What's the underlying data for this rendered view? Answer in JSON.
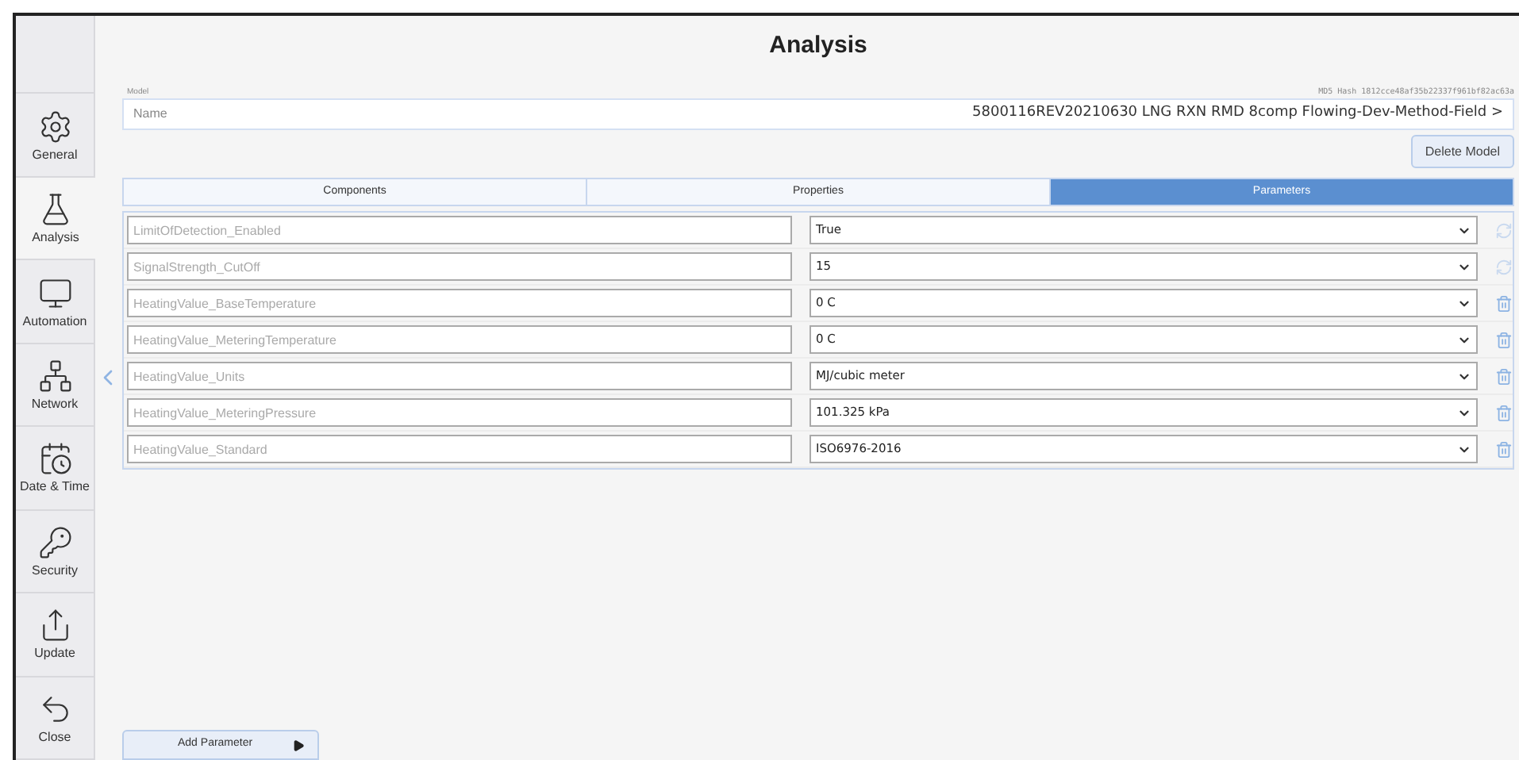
{
  "title": "Analysis",
  "sidebar": {
    "items": [
      {
        "kind": "gear",
        "label": "General",
        "selected": false
      },
      {
        "kind": "flask",
        "label": "Analysis",
        "selected": true
      },
      {
        "kind": "monitor",
        "label": "Automation",
        "selected": false
      },
      {
        "kind": "network",
        "label": "Network",
        "selected": false
      },
      {
        "kind": "calendar",
        "label": "Date & Time",
        "selected": false
      },
      {
        "kind": "key",
        "label": "Security",
        "selected": false
      },
      {
        "kind": "upload",
        "label": "Update",
        "selected": false
      },
      {
        "kind": "back",
        "label": "Close",
        "selected": false
      }
    ]
  },
  "model": {
    "label": "Model",
    "hash": "MD5 Hash 1812cce48af35b22337f961bf82ac63a",
    "name_label": "Name",
    "name_value": "5800116REV20210630 LNG RXN RMD 8comp Flowing-Dev-Method-Field >",
    "delete_button": "Delete Model"
  },
  "tabs": [
    {
      "label": "Components",
      "selected": false
    },
    {
      "label": "Properties",
      "selected": false
    },
    {
      "label": "Parameters",
      "selected": true
    }
  ],
  "parameters": [
    {
      "placeholder": "LimitOfDetection_Enabled",
      "value": "True",
      "kind": "reset"
    },
    {
      "placeholder": "SignalStrength_CutOff",
      "value": "15",
      "kind": "reset"
    },
    {
      "placeholder": "HeatingValue_BaseTemperature",
      "value": "0 C",
      "kind": "delete"
    },
    {
      "placeholder": "HeatingValue_MeteringTemperature",
      "value": "0 C",
      "kind": "delete"
    },
    {
      "placeholder": "HeatingValue_Units",
      "value": "MJ/cubic meter",
      "kind": "delete"
    },
    {
      "placeholder": "HeatingValue_MeteringPressure",
      "value": "101.325 kPa",
      "kind": "delete"
    },
    {
      "placeholder": "HeatingValue_Standard",
      "value": "ISO6976-2016",
      "kind": "delete"
    }
  ],
  "add_button": "Add Parameter"
}
